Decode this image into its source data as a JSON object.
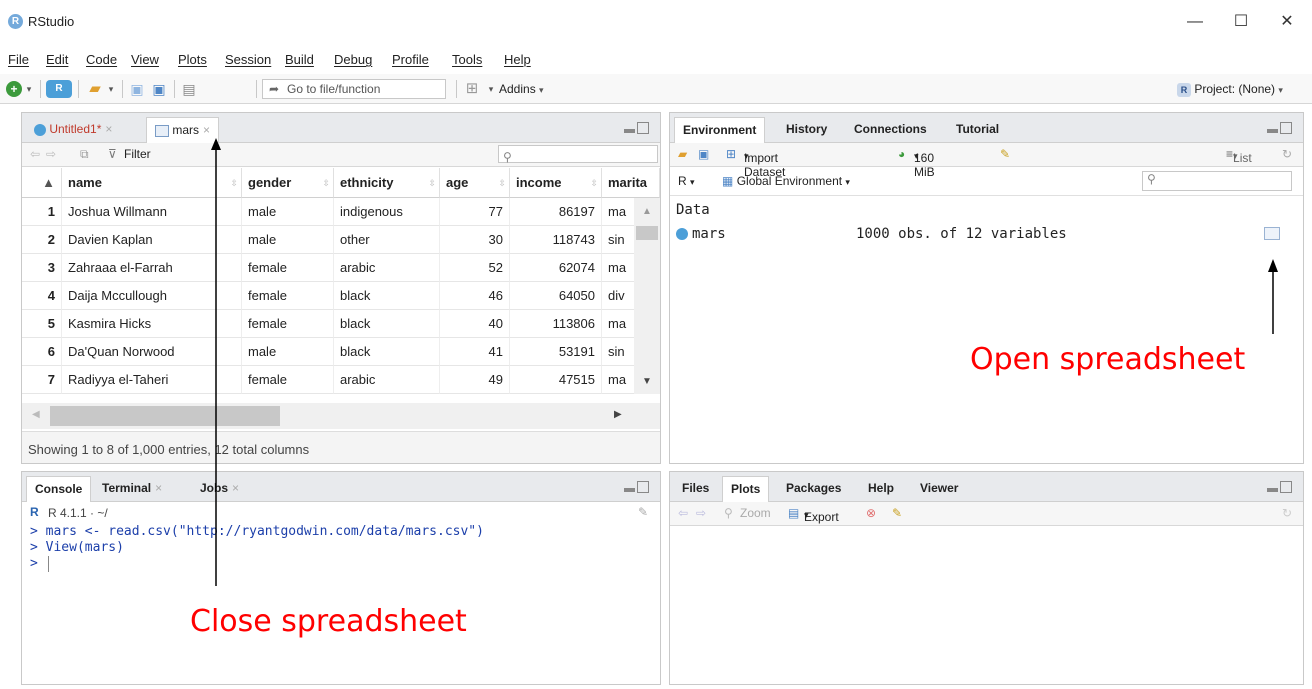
{
  "window": {
    "title": "RStudio",
    "app_icon": "R",
    "minimize": "—",
    "maximize": "☐",
    "close": "✕"
  },
  "menu": [
    "File",
    "Edit",
    "Code",
    "View",
    "Plots",
    "Session",
    "Build",
    "Debug",
    "Profile",
    "Tools",
    "Help"
  ],
  "toolbar": {
    "goto_placeholder": "Go to file/function",
    "addins": "Addins",
    "project": "Project: (None)"
  },
  "source_pane": {
    "tabs": [
      {
        "label": "Untitled1*",
        "close": "×"
      },
      {
        "label": "mars",
        "close": "×"
      }
    ],
    "filter_label": "Filter",
    "columns": [
      "name",
      "gender",
      "ethnicity",
      "age",
      "income",
      "marita"
    ],
    "rows": [
      {
        "idx": "1",
        "name": "Joshua Willmann",
        "gender": "male",
        "ethnicity": "indigenous",
        "age": "77",
        "income": "86197",
        "marital": "ma"
      },
      {
        "idx": "2",
        "name": "Davien Kaplan",
        "gender": "male",
        "ethnicity": "other",
        "age": "30",
        "income": "118743",
        "marital": "sin"
      },
      {
        "idx": "3",
        "name": "Zahraaa el-Farrah",
        "gender": "female",
        "ethnicity": "arabic",
        "age": "52",
        "income": "62074",
        "marital": "ma"
      },
      {
        "idx": "4",
        "name": "Daija Mccullough",
        "gender": "female",
        "ethnicity": "black",
        "age": "46",
        "income": "64050",
        "marital": "div"
      },
      {
        "idx": "5",
        "name": "Kasmira Hicks",
        "gender": "female",
        "ethnicity": "black",
        "age": "40",
        "income": "113806",
        "marital": "ma"
      },
      {
        "idx": "6",
        "name": "Da'Quan Norwood",
        "gender": "male",
        "ethnicity": "black",
        "age": "41",
        "income": "53191",
        "marital": "sin"
      },
      {
        "idx": "7",
        "name": "Radiyya el-Taheri",
        "gender": "female",
        "ethnicity": "arabic",
        "age": "49",
        "income": "47515",
        "marital": "ma"
      }
    ],
    "status": "Showing 1 to 8 of 1,000 entries, 12 total columns"
  },
  "env_pane": {
    "tabs": [
      "Environment",
      "History",
      "Connections",
      "Tutorial"
    ],
    "import_dataset": "Import Dataset",
    "memory": "160 MiB",
    "view_mode": "List",
    "lang": "R",
    "scope": "Global Environment",
    "section": "Data",
    "object_name": "mars",
    "object_desc": "1000 obs. of 12 variables"
  },
  "console_pane": {
    "tabs": [
      {
        "label": "Console"
      },
      {
        "label": "Terminal",
        "close": "×"
      },
      {
        "label": "Jobs",
        "close": "×"
      }
    ],
    "version": "R 4.1.1 · ~/",
    "lines": [
      "> mars <- read.csv(\"http://ryantgodwin.com/data/mars.csv\")",
      "> View(mars)",
      ">"
    ]
  },
  "files_pane": {
    "tabs": [
      "Files",
      "Plots",
      "Packages",
      "Help",
      "Viewer"
    ],
    "zoom": "Zoom",
    "export": "Export"
  },
  "annotations": {
    "open": "Open spreadsheet",
    "close": "Close spreadsheet"
  },
  "colors": {
    "annotation": "#ff0000",
    "console_text": "#1c3faa",
    "r_blue": "#75aadb"
  }
}
